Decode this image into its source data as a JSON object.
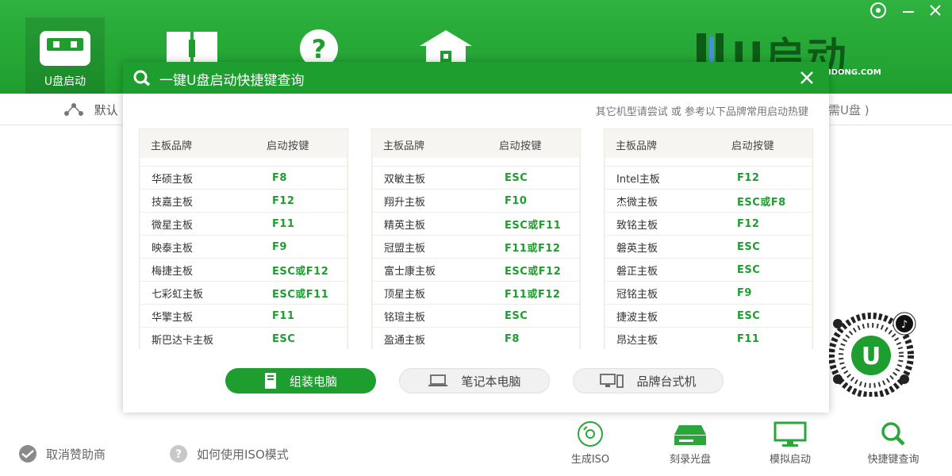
{
  "app": {
    "logo_text": "U启动",
    "logo_url": "IDONG.COM"
  },
  "nav": {
    "items": [
      {
        "label": "U盘启动",
        "icon": "usb-drive-icon",
        "active": true
      },
      {
        "label": "",
        "icon": "book-icon",
        "active": false
      },
      {
        "label": "",
        "icon": "help-icon",
        "active": false
      },
      {
        "label": "",
        "icon": "home-icon",
        "active": false
      }
    ]
  },
  "subbar": {
    "left_label": "默认",
    "right_label": "需U盘 )"
  },
  "dialog": {
    "title": "一键U盘启动快捷键查询",
    "hint": "其它机型请尝试 或 参考以下品牌常用启动热键",
    "col_brand": "主板品牌",
    "col_key": "启动按键",
    "tables": [
      {
        "rows": [
          {
            "brand": "华硕主板",
            "key": "F8"
          },
          {
            "brand": "技嘉主板",
            "key": "F12"
          },
          {
            "brand": "微星主板",
            "key": "F11"
          },
          {
            "brand": "映泰主板",
            "key": "F9"
          },
          {
            "brand": "梅捷主板",
            "key": "ESC或F12"
          },
          {
            "brand": "七彩虹主板",
            "key": "ESC或F11"
          },
          {
            "brand": "华擎主板",
            "key": "F11"
          },
          {
            "brand": "斯巴达卡主板",
            "key": "ESC"
          }
        ]
      },
      {
        "rows": [
          {
            "brand": "双敏主板",
            "key": "ESC"
          },
          {
            "brand": "翔升主板",
            "key": "F10"
          },
          {
            "brand": "精英主板",
            "key": "ESC或F11"
          },
          {
            "brand": "冠盟主板",
            "key": "F11或F12"
          },
          {
            "brand": "富士康主板",
            "key": "ESC或F12"
          },
          {
            "brand": "顶星主板",
            "key": "F11或F12"
          },
          {
            "brand": "铭瑄主板",
            "key": "ESC"
          },
          {
            "brand": "盈通主板",
            "key": "F8"
          }
        ]
      },
      {
        "rows": [
          {
            "brand": "Intel主板",
            "key": "F12"
          },
          {
            "brand": "杰微主板",
            "key": "ESC或F8"
          },
          {
            "brand": "致铭主板",
            "key": "F12"
          },
          {
            "brand": "磐英主板",
            "key": "ESC"
          },
          {
            "brand": "磐正主板",
            "key": "ESC"
          },
          {
            "brand": "冠铭主板",
            "key": "F9"
          },
          {
            "brand": "捷波主板",
            "key": "ESC"
          },
          {
            "brand": "昂达主板",
            "key": "F11"
          }
        ]
      }
    ],
    "type_buttons": [
      {
        "label": "组装电脑",
        "active": true
      },
      {
        "label": "笔记本电脑",
        "active": false
      },
      {
        "label": "品牌台式机",
        "active": false
      }
    ]
  },
  "bottom": {
    "links": [
      {
        "label": "取消赞助商"
      },
      {
        "label": "如何使用ISO模式"
      }
    ],
    "tools": [
      {
        "label": "生成ISO"
      },
      {
        "label": "刻录光盘"
      },
      {
        "label": "模拟启动"
      },
      {
        "label": "快捷键查询"
      }
    ]
  },
  "colors": {
    "brand_green": "#1e9e2e",
    "key_green": "#1e9e2e"
  }
}
